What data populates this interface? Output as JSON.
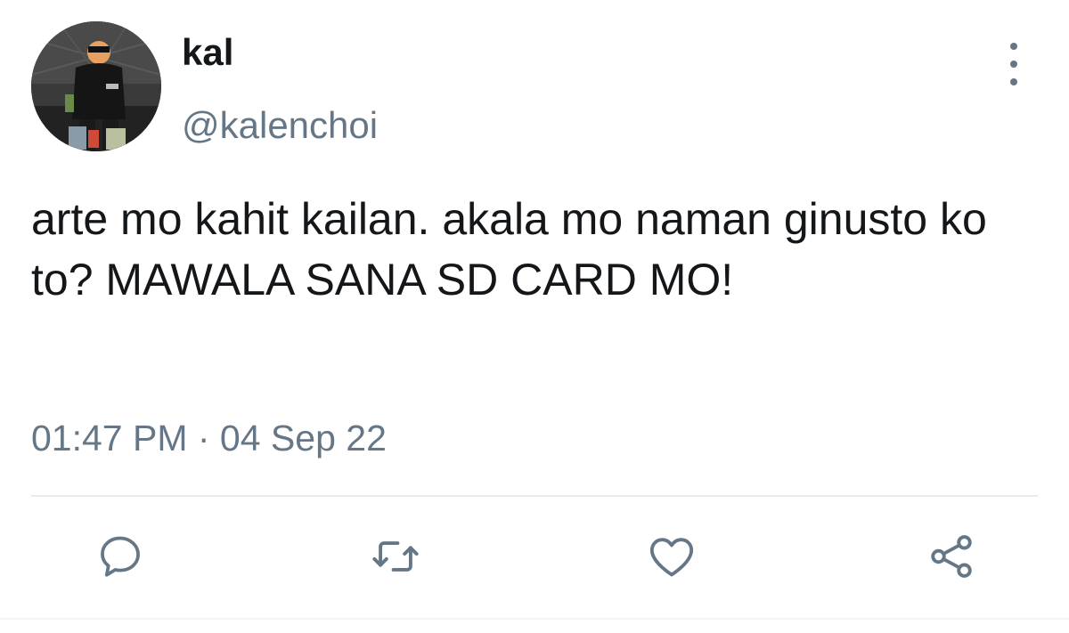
{
  "tweet": {
    "display_name": "kal",
    "handle": "@kalenchoi",
    "text": "arte mo kahit kailan. akala mo naman ginusto ko to? MAWALA SANA SD CARD MO!",
    "timestamp": "01:47 PM · 04 Sep 22"
  },
  "icons": {
    "more": "more-vertical-icon",
    "reply": "reply-icon",
    "retweet": "retweet-icon",
    "like": "heart-icon",
    "share": "share-icon"
  },
  "colors": {
    "text_primary": "#14171a",
    "text_secondary": "#657786",
    "divider": "#e6ecf0"
  }
}
